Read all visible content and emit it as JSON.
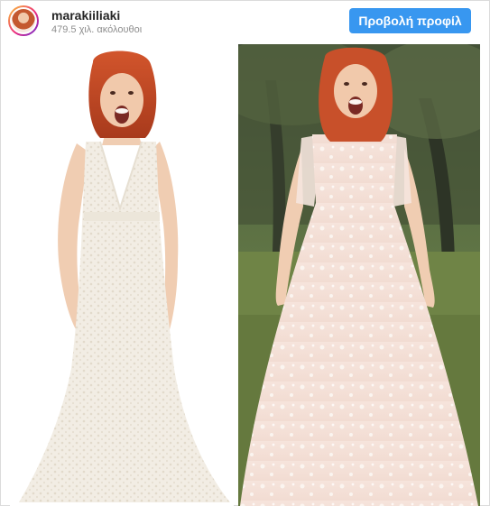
{
  "post": {
    "username": "marakiiliaki",
    "followers": "479.5 χιλ. ακόλουθοι",
    "profile_button": "Προβολή προφίλ",
    "accent_color": "#3897f0"
  },
  "photos": [
    {
      "name": "left-dress-photo",
      "icon": "lace-mermaid-dress"
    },
    {
      "name": "right-dress-photo",
      "icon": "off-shoulder-ball-gown"
    }
  ]
}
